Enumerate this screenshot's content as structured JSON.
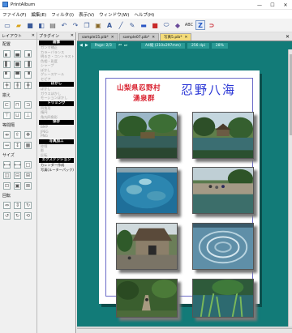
{
  "window": {
    "title": "PrintAlbum"
  },
  "window_buttons": [
    "—",
    "☐",
    "✕"
  ],
  "menu": [
    "ファイル(F)",
    "編集(E)",
    "フィルタ(I)",
    "表示(V)",
    "ウィンドウ(W)",
    "ヘルプ(H)"
  ],
  "toolbar": {
    "text_tool": "A",
    "z_label": "Z",
    "abc_label": "ABC"
  },
  "layout_panel": {
    "title": "レイアウト",
    "sections": [
      "配置",
      "揃え",
      "等間隔",
      "サイズ",
      "回転"
    ]
  },
  "plugin_panel": {
    "title": "プラグイン",
    "groups": [
      {
        "head": "画像",
        "items": [
          "ガンマ補正",
          "カラーバランス",
          "明るさ・コントラスト",
          "色相・彩度",
          "シャープ",
          "ぼかし",
          "グレースケール",
          "セピア"
        ]
      },
      {
        "head": "ぼかし",
        "items": [
          "ぼかし",
          "ガウスぼかし",
          "モーションぼかし"
        ]
      },
      {
        "head": "トリミング",
        "items": [
          "四角形",
          "楕円",
          "角丸四角形"
        ]
      },
      {
        "head": "保存",
        "items": [
          "BMP",
          "JPEG",
          "PNG"
        ]
      },
      {
        "head": "写真加工",
        "items": [
          "枠線",
          "影",
          "反転"
        ]
      },
      {
        "head": "エクステンション",
        "items": [
          "カレンダー作成",
          "写真(ルーターパック)"
        ]
      }
    ]
  },
  "tabs": [
    {
      "label": "sample15.pib*",
      "active": false
    },
    {
      "label": "sample07.pib*",
      "active": false
    },
    {
      "label": "写真5.pib*",
      "active": true
    }
  ],
  "doc_info": {
    "page": "Page: 2/3",
    "paper": "A4縦 (210x297mm)",
    "dpi": "256 dpi",
    "zoom": "28%"
  },
  "document": {
    "title_location": "山梨県忍野村",
    "title_sub": "湧泉群",
    "title_main": "忍野八海"
  },
  "photos": [
    "pond-with-trees",
    "gazebo-pond",
    "clear-water-rocks",
    "visitors-pond",
    "thatched-house",
    "ripple-water",
    "path-trees",
    "water-plants"
  ]
}
